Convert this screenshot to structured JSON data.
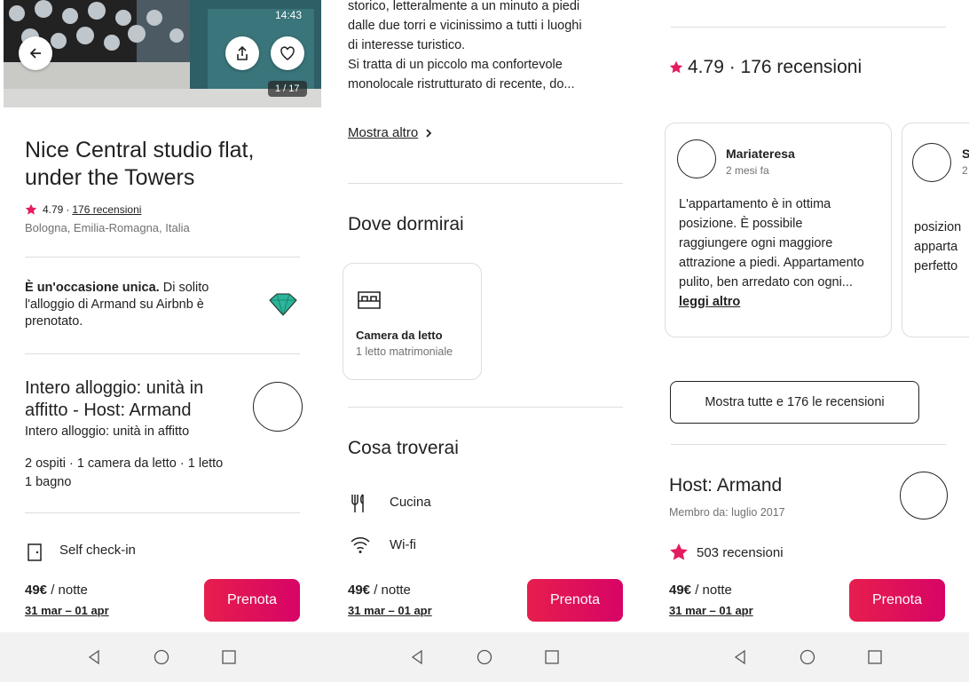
{
  "colors": {
    "brand": "#e61e4d",
    "star": "#e31c5f",
    "text": "#222222",
    "muted": "#717171",
    "divider": "#dddddd"
  },
  "screen1": {
    "status_left": "",
    "status_right": "14:43",
    "photo_counter": "1 / 17",
    "title": "Nice Central studio flat, under the Towers",
    "rating": "4.79",
    "rating_sep": "·",
    "reviews_link": "176 recensioni",
    "location": "Bologna, Emilia-Romagna, Italia",
    "rare_bold": "È un'occasione unica.",
    "rare_text": " Di solito l'alloggio di Armand su Airbnb è prenotato.",
    "host_title": "Intero alloggio: unità in affitto - Host: Armand",
    "host_subtitle": "Intero alloggio: unità in affitto",
    "details_line1": "2 ospiti · 1 camera da letto · 1 letto",
    "details_line2": "1 bagno",
    "self_checkin": "Self check-in",
    "price": "49€",
    "per_night": " / notte",
    "dates": "31 mar – 01 apr",
    "reserve": "Prenota"
  },
  "screen2": {
    "desc_line0": "storico, letteralmente a un minuto a piedi",
    "desc_line1": "dalle due torri e vicinissimo a tutti i luoghi",
    "desc_line2": "di interesse turistico.",
    "desc_line3": "Si tratta di un piccolo ma confortevole",
    "desc_line4": "monolocale ristrutturato di recente, do...",
    "show_more": "Mostra altro",
    "sleep_title": "Dove dormirai",
    "bedroom_title": "Camera da letto",
    "bedroom_sub": "1 letto matrimoniale",
    "amenities_title": "Cosa troverai",
    "amenity_kitchen": "Cucina",
    "amenity_wifi": "Wi-fi",
    "price": "49€",
    "per_night": " / notte",
    "dates": "31 mar – 01 apr",
    "reserve": "Prenota"
  },
  "screen3": {
    "rating_header": "4.79 · 176 recensioni",
    "review1_name": "Mariateresa",
    "review1_date": "2 mesi fa",
    "review1_text": "L'appartamento è in ottima posizione. È possibile raggiungere ogni maggiore attrazione a piedi. Appartamento pulito, ben arredato con ogni...",
    "review1_more": "leggi altro",
    "review2_name": "S",
    "review2_date": "2",
    "review2_line1": "posizion",
    "review2_line2": "apparta",
    "review2_line3": "perfetto",
    "show_all_reviews": "Mostra tutte e 176 le recensioni",
    "host_title": "Host: Armand",
    "host_since": "Membro da: luglio 2017",
    "host_reviews": "503 recensioni",
    "price": "49€",
    "per_night": " / notte",
    "dates": "31 mar – 01 apr",
    "reserve": "Prenota"
  },
  "navbar": {
    "back": "back-triangle-icon",
    "home": "home-circle-icon",
    "recent": "recent-square-icon"
  }
}
